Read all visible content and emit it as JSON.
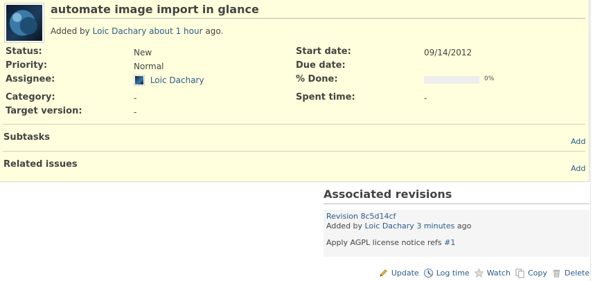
{
  "issue": {
    "title": "automate image import in glance",
    "added_by_prefix": "Added by",
    "author": "Loic Dachary",
    "age": "about 1 hour",
    "age_suffix": "ago."
  },
  "attributes": {
    "status_label": "Status:",
    "status_value": "New",
    "priority_label": "Priority:",
    "priority_value": "Normal",
    "assignee_label": "Assignee:",
    "assignee_value": "Loic Dachary",
    "category_label": "Category:",
    "category_value": "-",
    "target_version_label": "Target version:",
    "target_version_value": "-",
    "start_date_label": "Start date:",
    "start_date_value": "09/14/2012",
    "due_date_label": "Due date:",
    "due_date_value": "",
    "done_label": "% Done:",
    "done_value": "0%",
    "done_fraction": 0,
    "spent_time_label": "Spent time:",
    "spent_time_value": "-"
  },
  "subtasks": {
    "title": "Subtasks",
    "add_label": "Add"
  },
  "related": {
    "title": "Related issues",
    "add_label": "Add"
  },
  "revisions": {
    "heading": "Associated revisions",
    "revision_link": "Revision 8c5d14cf",
    "added_by": "Added by",
    "author": "Loic Dachary",
    "age": "3 minutes",
    "age_suffix": "ago",
    "message": "Apply AGPL license notice refs",
    "issue_ref": "#1"
  },
  "actions": {
    "update": "Update",
    "log_time": "Log time",
    "watch": "Watch",
    "copy": "Copy",
    "delete": "Delete"
  },
  "colors": {
    "issue_bg": "#ffffdd",
    "link": "#2a5a8a",
    "revision_bg": "#f5f5f5"
  },
  "icons": [
    "pencil-icon",
    "clock-icon",
    "star-icon",
    "copy-icon",
    "trash-icon"
  ]
}
